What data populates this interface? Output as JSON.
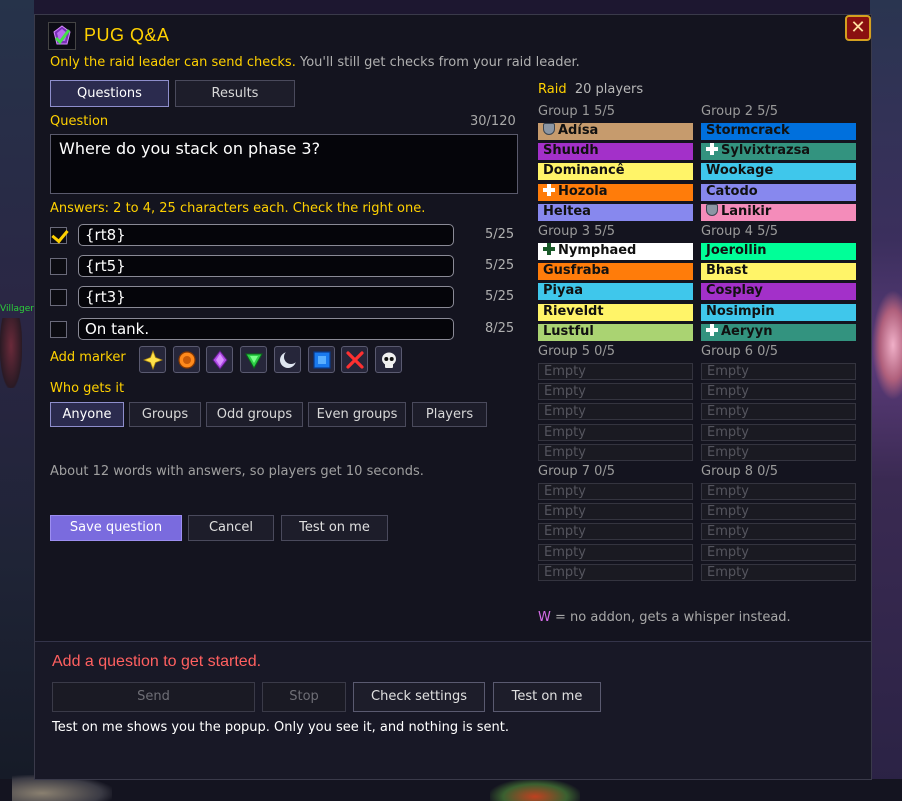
{
  "background": {
    "npc_label": "Villager"
  },
  "window": {
    "title": "PUG Q&A",
    "close_label": "✕",
    "subtitle_highlight": "Only the raid leader can send checks.",
    "subtitle_rest": "You'll still get checks from your raid leader."
  },
  "tabs": [
    {
      "label": "Questions",
      "active": true
    },
    {
      "label": "Results",
      "active": false
    }
  ],
  "question": {
    "label": "Question",
    "counter": "30/120",
    "text": "Where do you stack on phase 3?"
  },
  "answers": {
    "label": "Answers: 2 to 4, 25 characters each. Check the right one.",
    "items": [
      {
        "text": "{rt8}",
        "count": "5/25",
        "checked": true
      },
      {
        "text": "{rt5}",
        "count": "5/25",
        "checked": false
      },
      {
        "text": "{rt3}",
        "count": "5/25",
        "checked": false
      },
      {
        "text": "On tank.",
        "count": "8/25",
        "checked": false
      }
    ]
  },
  "markers": {
    "label": "Add marker",
    "icons": [
      "star-icon",
      "circle-icon",
      "diamond-icon",
      "triangle-icon",
      "moon-icon",
      "square-icon",
      "cross-icon",
      "skull-icon"
    ]
  },
  "who": {
    "label": "Who gets it",
    "options": [
      "Anyone",
      "Groups",
      "Odd groups",
      "Even groups",
      "Players"
    ],
    "selected": "Anyone"
  },
  "info": "About 12 words with answers, so players get 10 seconds.",
  "actions": {
    "save": "Save question",
    "cancel": "Cancel",
    "test": "Test on me"
  },
  "raid": {
    "title": "Raid",
    "count": "20 players",
    "empty_label": "Empty",
    "groups": [
      {
        "label": "Group 1  5/5",
        "members": [
          {
            "name": "Adísa",
            "color": "#C69B6D",
            "icon": "shield"
          },
          {
            "name": "Shuudh",
            "color": "#A330C9",
            "icon": ""
          },
          {
            "name": "Dominancê",
            "color": "#FFF468",
            "icon": ""
          },
          {
            "name": "Hozola",
            "color": "#FF7C0A",
            "icon": "cross"
          },
          {
            "name": "Heltea",
            "color": "#8788EE",
            "icon": ""
          }
        ]
      },
      {
        "label": "Group 2  5/5",
        "members": [
          {
            "name": "Stormcrack",
            "color": "#0070DD",
            "icon": ""
          },
          {
            "name": "Sylvixtrazsa",
            "color": "#33937F",
            "icon": "cross"
          },
          {
            "name": "Wookage",
            "color": "#3FC7EB",
            "icon": ""
          },
          {
            "name": "Catodo",
            "color": "#8788EE",
            "icon": ""
          },
          {
            "name": "Lanikir",
            "color": "#F48CBA",
            "icon": "shield"
          }
        ]
      },
      {
        "label": "Group 3  5/5",
        "members": [
          {
            "name": "Nymphaed",
            "color": "#FFFFFF",
            "icon": "cross-dark"
          },
          {
            "name": "Gusfraba",
            "color": "#FF7C0A",
            "icon": ""
          },
          {
            "name": "Piyaa",
            "color": "#3FC7EB",
            "icon": ""
          },
          {
            "name": "Rieveldt",
            "color": "#FFF468",
            "icon": ""
          },
          {
            "name": "Lustful",
            "color": "#AAD372",
            "icon": ""
          }
        ]
      },
      {
        "label": "Group 4  5/5",
        "members": [
          {
            "name": "Joerollin",
            "color": "#00FF98",
            "icon": ""
          },
          {
            "name": "Bhast",
            "color": "#FFF468",
            "icon": ""
          },
          {
            "name": "Cosplay",
            "color": "#A330C9",
            "icon": ""
          },
          {
            "name": "Nosimpin",
            "color": "#3FC7EB",
            "icon": ""
          },
          {
            "name": "Aeryyn",
            "color": "#33937F",
            "icon": "cross"
          }
        ]
      },
      {
        "label": "Group 5  0/5",
        "members": []
      },
      {
        "label": "Group 6  0/5",
        "members": []
      },
      {
        "label": "Group 7  0/5",
        "members": []
      },
      {
        "label": "Group 8  0/5",
        "members": []
      }
    ],
    "legend_w": "W",
    "legend_text": "= no addon, gets a whisper instead."
  },
  "footer": {
    "status": "Add a question to get started.",
    "send": "Send",
    "stop": "Stop",
    "check_settings": "Check settings",
    "test": "Test on me",
    "note": "Test on me shows you the popup. Only you see it, and nothing is sent."
  }
}
